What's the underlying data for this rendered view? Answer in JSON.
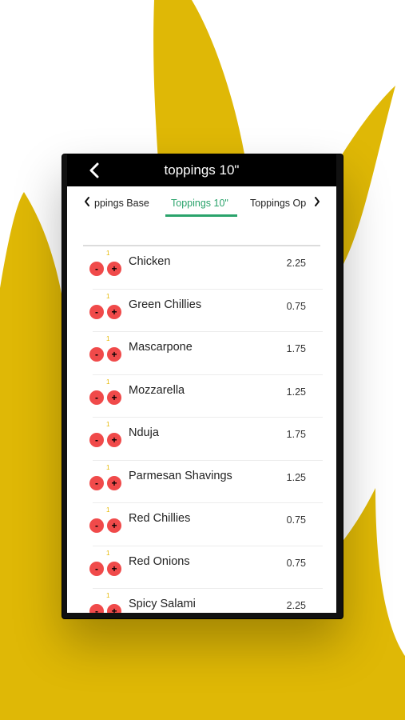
{
  "colors": {
    "flame": "#dfb806",
    "navbar": "#000000",
    "accent": "#2aa36b",
    "qty_button": "#f04a4a"
  },
  "navbar": {
    "title": "toppings 10\"",
    "back_icon": "chevron-left-icon"
  },
  "tabs": {
    "left_icon": "chevron-left-icon",
    "right_icon": "chevron-right-icon",
    "items": [
      {
        "label": "ppings Base"
      },
      {
        "label": "Toppings 10\"",
        "active": true
      },
      {
        "label": "Toppings Op"
      }
    ]
  },
  "controls": {
    "minus": "-",
    "plus": "+",
    "qty": "1"
  },
  "items": [
    {
      "name": "Chicken",
      "price": "2.25"
    },
    {
      "name": "Green Chillies",
      "price": "0.75"
    },
    {
      "name": "Mascarpone",
      "price": "1.75"
    },
    {
      "name": "Mozzarella",
      "price": "1.25"
    },
    {
      "name": "Nduja",
      "price": "1.75"
    },
    {
      "name": "Parmesan Shavings",
      "price": "1.25"
    },
    {
      "name": "Red Chillies",
      "price": "0.75"
    },
    {
      "name": "Red Onions",
      "price": "0.75"
    },
    {
      "name": "Spicy Salami",
      "price": "2.25"
    }
  ]
}
